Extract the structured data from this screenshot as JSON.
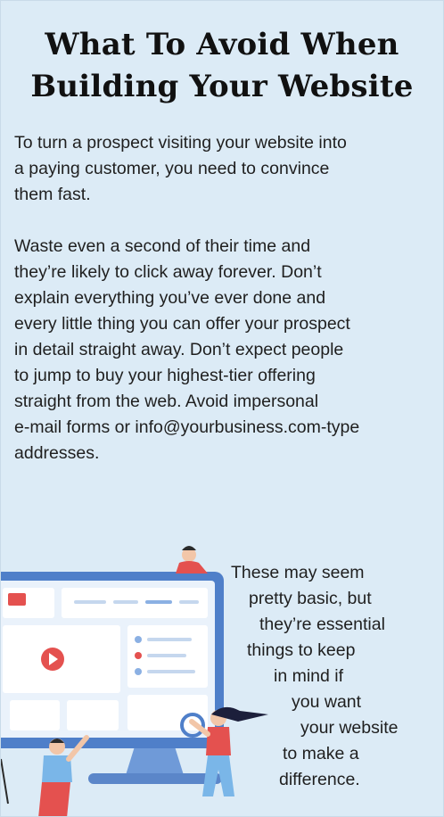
{
  "title": {
    "line1": "What To Avoid When",
    "line2": "Building Your Website"
  },
  "paragraphs": [
    {
      "lines": [
        "To turn a prospect visiting your website into",
        "a paying customer, you need to convince",
        "them fast."
      ]
    },
    {
      "lines": [
        "Waste even a second of their time and",
        "they’re likely to click away forever. Don’t",
        "explain everything you’ve ever done and",
        "every little thing you can offer your prospect",
        "in detail straight away. Don’t expect people",
        "to jump to buy your highest-tier offering",
        "straight from the web. Avoid impersonal",
        "e-mail forms or info@yourbusiness.com-type",
        "addresses."
      ]
    }
  ],
  "closing": {
    "lines": [
      "These may seem",
      "pretty basic, but",
      "they’re essential",
      "things to keep",
      "in mind if",
      "you want",
      "your website",
      "to make a",
      "difference."
    ]
  },
  "colors": {
    "background": "#dcebf6",
    "monitor": "#4f7fc9",
    "accent_red": "#e4514f"
  }
}
